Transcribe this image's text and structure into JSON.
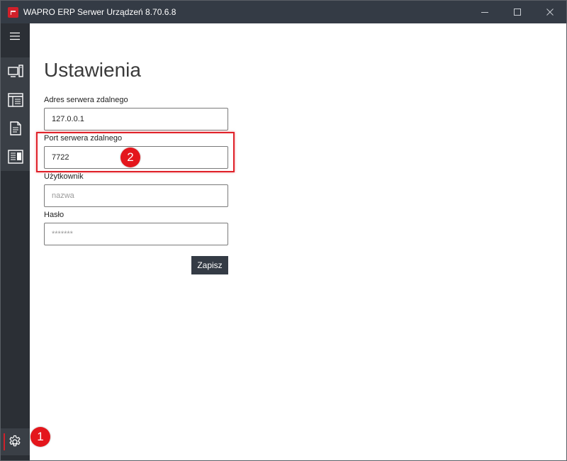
{
  "window": {
    "title": "WAPRO ERP Serwer Urządzeń 8.70.6.8"
  },
  "sidebar": {
    "items": [
      {
        "icon": "devices-icon"
      },
      {
        "icon": "window-list-icon"
      },
      {
        "icon": "document-icon"
      },
      {
        "icon": "log-list-icon"
      }
    ],
    "settings_icon": "gear-icon"
  },
  "settings": {
    "title": "Ustawienia",
    "server_address": {
      "label": "Adres serwera zdalnego",
      "value": "127.0.0.1"
    },
    "server_port": {
      "label": "Port serwera zdalnego",
      "value": "7722"
    },
    "user": {
      "label": "Użytkownik",
      "value": "",
      "placeholder": "nazwa"
    },
    "password": {
      "label": "Hasło",
      "value": "",
      "placeholder": "*******"
    },
    "save_label": "Zapisz"
  },
  "annotations": {
    "marker_1": "1",
    "marker_2": "2",
    "color": "#e4161c"
  }
}
